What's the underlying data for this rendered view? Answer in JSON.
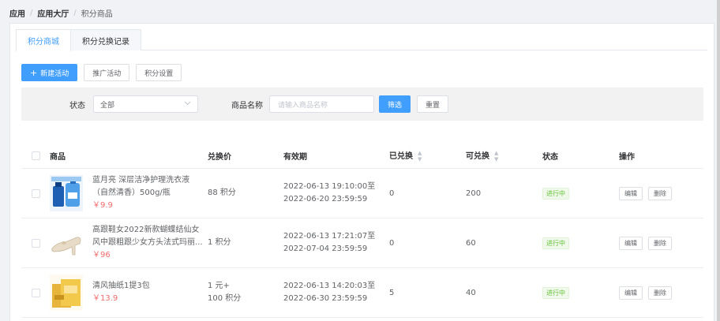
{
  "breadcrumb": {
    "items": [
      "应用",
      "应用大厅",
      "积分商品"
    ],
    "separator": "/"
  },
  "tabs": [
    {
      "label": "积分商城",
      "active": true
    },
    {
      "label": "积分兑换记录",
      "active": false
    }
  ],
  "toolbar": {
    "new_label": "新建活动",
    "promote_label": "推广活动",
    "settings_label": "积分设置",
    "plus": "+"
  },
  "filter": {
    "status_label": "状态",
    "status_value": "全部",
    "name_label": "商品名称",
    "name_placeholder": "请输入商品名称",
    "filter_button": "筛选",
    "reset_button": "重置"
  },
  "table": {
    "headers": {
      "product": "商品",
      "price": "兑换价",
      "validity": "有效期",
      "exchanged": "已兑换",
      "available": "可兑换",
      "status": "状态",
      "actions": "操作"
    },
    "rows": [
      {
        "name_line1": "蓝月亮 深层洁净护理洗衣液",
        "name_line2": "（自然清香）500g/瓶",
        "price": "￥9.9",
        "points_line1": "88 积分",
        "points_line2": "",
        "valid_from": "2022-06-13 19:10:00至",
        "valid_to": "2022-06-20 23:59:59",
        "exchanged": "0",
        "available": "200",
        "status": "进行中",
        "edit": "编辑",
        "delete": "删除",
        "thumb_icon": "detergent-bottle-icon"
      },
      {
        "name_line1": "高跟鞋女2022新款蝴蝶结仙女",
        "name_line2": "风中跟粗跟少女方头法式玛丽...",
        "price": "￥96",
        "points_line1": "1 积分",
        "points_line2": "",
        "valid_from": "2022-06-13 17:21:07至",
        "valid_to": "2022-07-04 23:59:59",
        "exchanged": "0",
        "available": "60",
        "status": "进行中",
        "edit": "编辑",
        "delete": "删除",
        "thumb_icon": "high-heel-shoe-icon"
      },
      {
        "name_line1": "清风抽纸1提3包",
        "name_line2": "",
        "price": "￥13.9",
        "points_line1": "1 元+",
        "points_line2": "100 积分",
        "valid_from": "2022-06-13 14:20:03至",
        "valid_to": "2022-06-30 23:59:59",
        "exchanged": "5",
        "available": "40",
        "status": "进行中",
        "edit": "编辑",
        "delete": "删除",
        "thumb_icon": "tissue-pack-icon"
      }
    ]
  },
  "colors": {
    "primary": "#409eff",
    "price": "#f56c6c",
    "status_green": "#67c23a"
  }
}
